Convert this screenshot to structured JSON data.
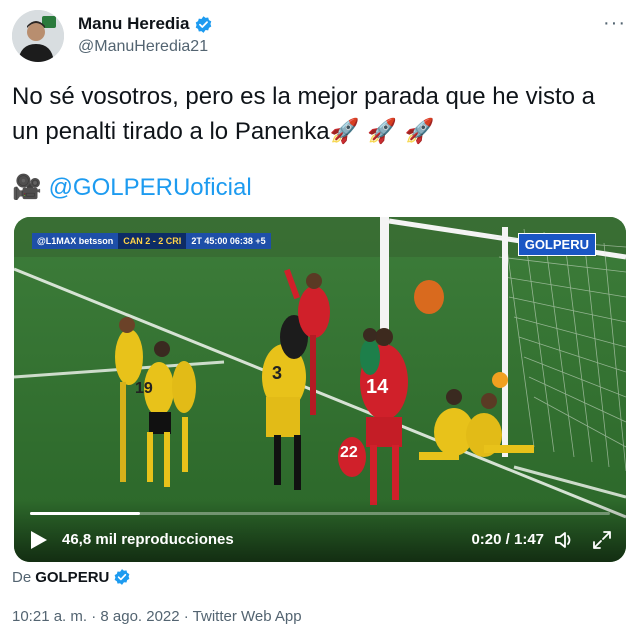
{
  "author": {
    "name": "Manu Heredia",
    "handle": "@ManuHeredia21"
  },
  "more_label": "···",
  "tweet": {
    "text": "No sé vosotros, pero es la mejor parada que he visto a un penalti tirado a lo Panenka",
    "emojis": "🚀 🚀 🚀",
    "camera_emoji": "🎥",
    "mention": "@GOLPERUoficial"
  },
  "video": {
    "scoreboard": {
      "league": "@L1MAX betsson",
      "score": "CAN 2 - 2 CRI",
      "clock": "2T 45:00 06:38 +5"
    },
    "watermark": "GOLPERU",
    "views": "46,8 mil reproducciones",
    "time": "0:20 / 1:47",
    "progress": 0.19,
    "players": [
      "22",
      "14",
      "3",
      "19"
    ]
  },
  "source": {
    "prefix": "De",
    "name": "GOLPERU"
  },
  "footer": "10:21 a. m. · 8 ago. 2022 · Twitter Web App",
  "colors": {
    "accent": "#1d9bf0",
    "pitch": "#2f6d2d",
    "home_kit": "#e8c21a",
    "away_kit": "#d0202a"
  }
}
